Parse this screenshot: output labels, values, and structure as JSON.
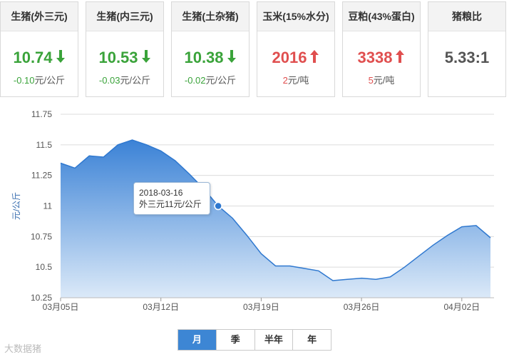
{
  "cards": [
    {
      "title": "生猪(外三元)",
      "price": "10.74",
      "change_num": "-0.10",
      "change_unit": "元/公斤",
      "direction": "down"
    },
    {
      "title": "生猪(内三元)",
      "price": "10.53",
      "change_num": "-0.03",
      "change_unit": "元/公斤",
      "direction": "down"
    },
    {
      "title": "生猪(土杂猪)",
      "price": "10.38",
      "change_num": "-0.02",
      "change_unit": "元/公斤",
      "direction": "down"
    },
    {
      "title": "玉米(15%水分)",
      "price": "2016",
      "change_num": "2",
      "change_unit": "元/吨",
      "direction": "up"
    },
    {
      "title": "豆粕(43%蛋白)",
      "price": "3338",
      "change_num": "5",
      "change_unit": "元/吨",
      "direction": "up"
    },
    {
      "title": "猪粮比",
      "price": "5.33:1",
      "change_num": "",
      "change_unit": "",
      "direction": "none"
    }
  ],
  "colors": {
    "down": "#3aa33a",
    "up": "#e04f4f",
    "area_top": "#3b82d6",
    "area_bottom": "#dbe9f8",
    "active_tab": "#3d86d4"
  },
  "chart_data": {
    "type": "area",
    "ylabel": "元/公斤",
    "ylim": [
      10.25,
      11.75
    ],
    "yticks": [
      "11.75",
      "11.5",
      "11.25",
      "11",
      "10.75",
      "10.5",
      "10.25"
    ],
    "xticks": [
      "03月05日",
      "03月12日",
      "03月19日",
      "03月26日",
      "04月02日"
    ],
    "x": [
      "03-05",
      "03-06",
      "03-07",
      "03-08",
      "03-09",
      "03-10",
      "03-11",
      "03-12",
      "03-13",
      "03-14",
      "03-15",
      "03-16",
      "03-17",
      "03-18",
      "03-19",
      "03-20",
      "03-21",
      "03-22",
      "03-23",
      "03-24",
      "03-25",
      "03-26",
      "03-27",
      "03-28",
      "03-29",
      "03-30",
      "03-31",
      "04-01",
      "04-02",
      "04-03",
      "04-04"
    ],
    "series": [
      {
        "values": [
          11.35,
          11.31,
          11.41,
          11.4,
          11.5,
          11.54,
          11.5,
          11.45,
          11.37,
          11.26,
          11.14,
          11.0,
          10.9,
          10.76,
          10.61,
          10.51,
          10.51,
          10.49,
          10.47,
          10.39,
          10.4,
          10.41,
          10.4,
          10.42,
          10.5,
          10.59,
          10.68,
          10.76,
          10.83,
          10.84,
          10.74
        ]
      }
    ],
    "highlight": {
      "date": "2018-03-16",
      "label": "外三元11元/公斤",
      "value": 11.0
    }
  },
  "tabs": [
    "月",
    "季",
    "半年",
    "年"
  ],
  "active_tab": "月",
  "watermark": "大数据猪"
}
